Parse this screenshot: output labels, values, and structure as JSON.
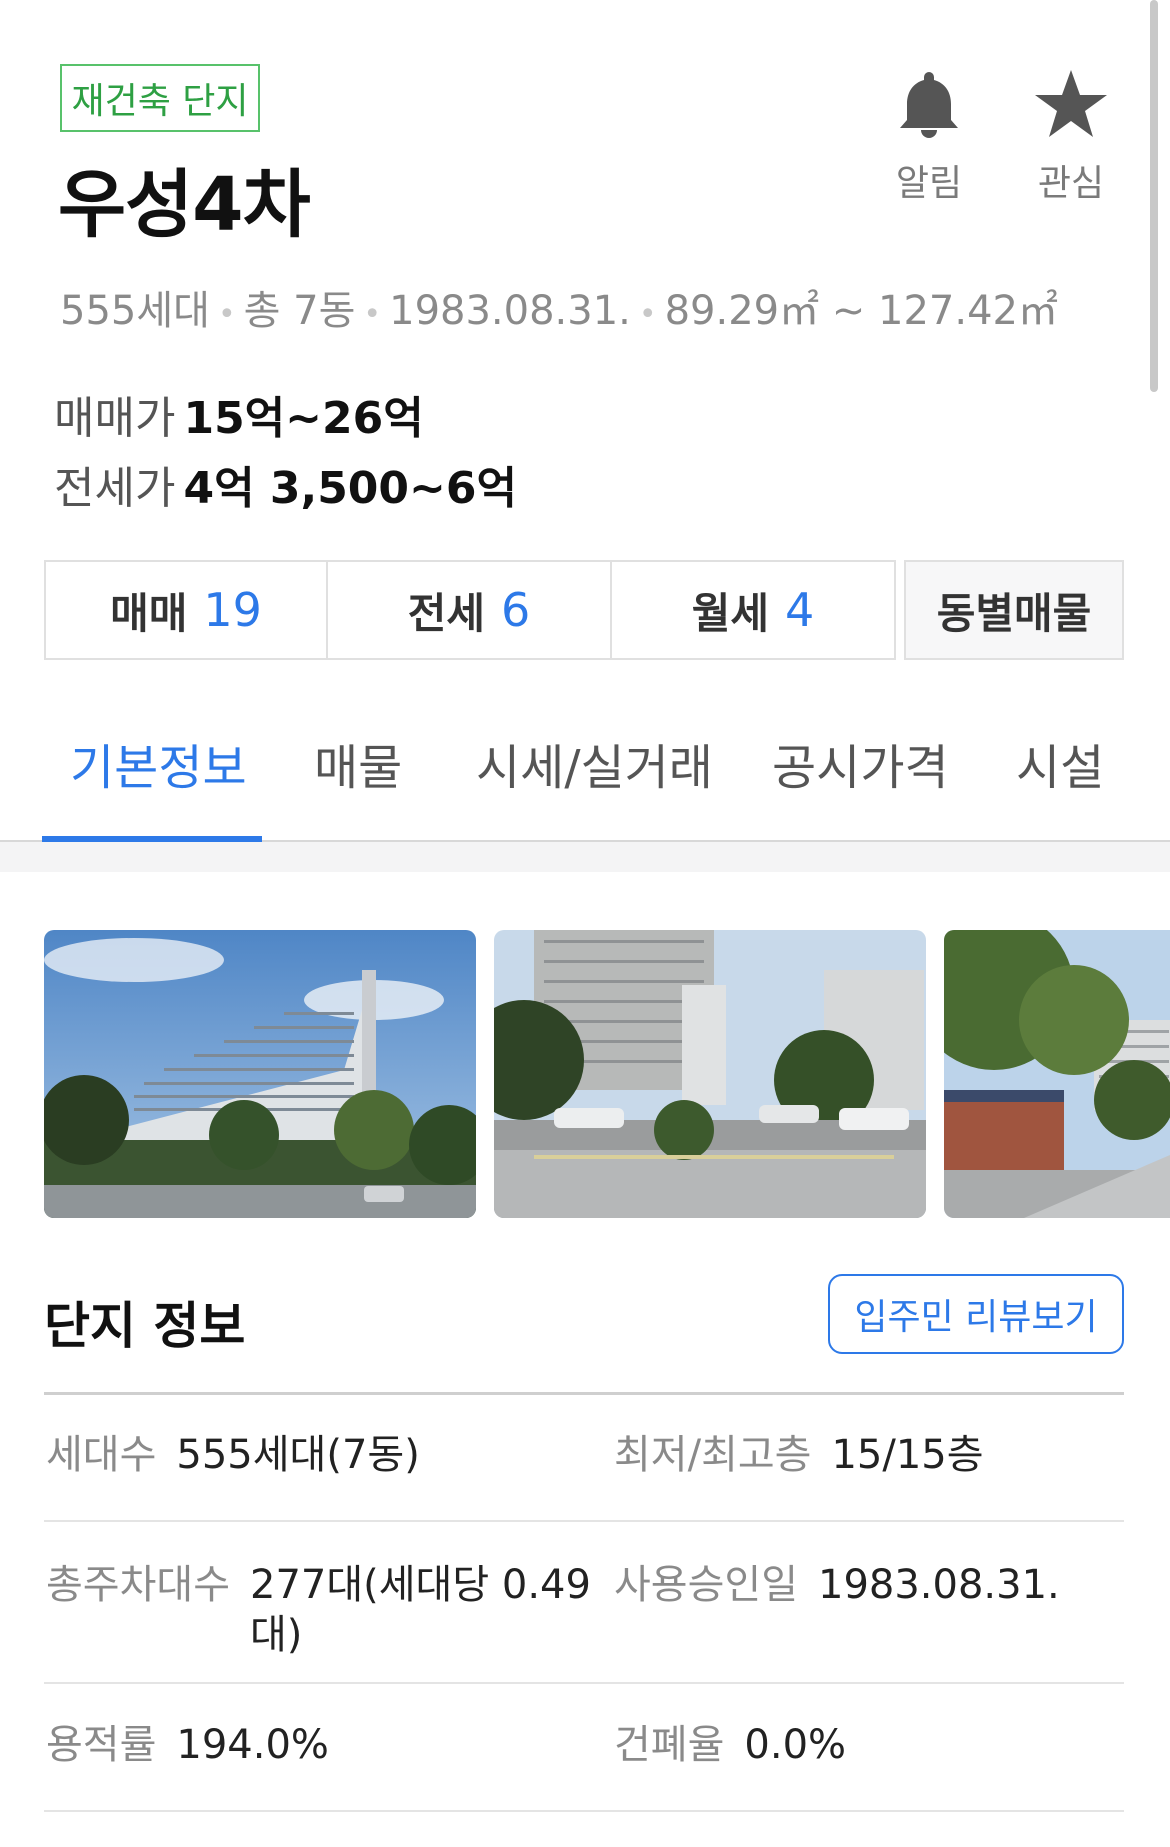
{
  "header": {
    "badge": "재건축 단지",
    "title": "우성4차",
    "actions": [
      {
        "label": "알림",
        "icon": "bell-icon"
      },
      {
        "label": "관심",
        "icon": "star-icon"
      }
    ],
    "meta": [
      "555세대",
      "총 7동",
      "1983.08.31.",
      "89.29㎡ ~ 127.42㎡"
    ],
    "prices": [
      {
        "label": "매매가",
        "value": "15억~26억"
      },
      {
        "label": "전세가",
        "value": "4억 3,500~6억"
      }
    ]
  },
  "trade_buttons": [
    {
      "label": "매매",
      "count": "19"
    },
    {
      "label": "전세",
      "count": "6"
    },
    {
      "label": "월세",
      "count": "4"
    },
    {
      "label": "동별매물",
      "count": ""
    }
  ],
  "tabs": [
    "기본정보",
    "매물",
    "시세/실거래",
    "공시가격",
    "시설"
  ],
  "active_tab": "기본정보",
  "photos": [
    "apartment-exterior-photo",
    "apartment-entrance-photo",
    "apartment-street-photo"
  ],
  "complex_info": {
    "title": "단지 정보",
    "review_button": "입주민 리뷰보기",
    "rows": [
      [
        {
          "key": "세대수",
          "value": "555세대(7동)"
        },
        {
          "key": "최저/최고층",
          "value": "15/15층"
        }
      ],
      [
        {
          "key": "총주차대수",
          "value_line1": "277대(세대당 0.49",
          "value_line2": "대)"
        },
        {
          "key": "사용승인일",
          "value": "1983.08.31."
        }
      ],
      [
        {
          "key": "용적률",
          "value": "194.0%"
        },
        {
          "key": "건폐율",
          "value": "0.0%"
        }
      ]
    ]
  },
  "colors": {
    "accent": "#2d79e8",
    "badge": "#58c26b"
  }
}
